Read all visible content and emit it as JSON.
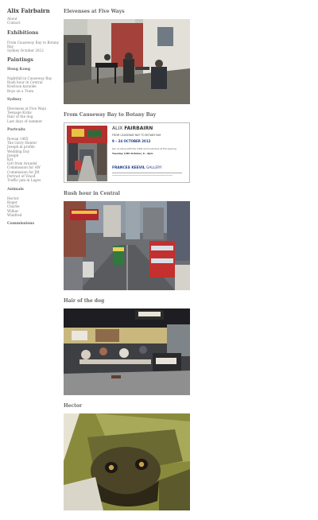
{
  "site": {
    "title": "Alix Fairbairn"
  },
  "nav": {
    "links": [
      "About",
      "Contact"
    ]
  },
  "exhibitions": {
    "heading": "Exhibitions",
    "items": [
      "From Causeway Bay to Botany",
      "Bay",
      "Sydney October 2012"
    ]
  },
  "paintings": {
    "heading": "Paintings"
  },
  "hongkong": {
    "heading": "Hong Kong",
    "items": [
      "Nightfall in Causeway Bay",
      "Rush hour in Central",
      "Kowloon karaoke",
      "Boys on a Tram"
    ]
  },
  "sydney": {
    "heading": "Sydney",
    "items": [
      "Elevenses at Five Ways",
      "Teenage Kicks",
      "Hair of the dog",
      "Last days of summer"
    ]
  },
  "portraits": {
    "heading": "Portraits",
    "items": [
      "Rowan 1465",
      "The Glory Hunter",
      "Joseph in profile",
      "Wedding Day",
      "Joseph",
      "Kat",
      "Girl from Arundel",
      "Commission for AW",
      "Commission for JM",
      "Portrait of Vinod",
      "Traffic jam in Lagos"
    ]
  },
  "animals": {
    "heading": "Animals",
    "items": [
      "Hector",
      "Roger",
      "Charlie",
      "Wilbur",
      "Winifred"
    ]
  },
  "commissions": {
    "heading": "Commissions"
  },
  "posts": [
    {
      "title": "Elevenses at Five Ways"
    },
    {
      "title": "From Causeway Bay to Botany Bay"
    },
    {
      "title": "Rush hour in Central"
    },
    {
      "title": "Hair of the dog"
    },
    {
      "title": "Hector"
    }
  ],
  "flyer": {
    "artist_first": "ALIX",
    "artist_last": "FAIRBAIRN",
    "show": "FROM CAUSEWAY BAY TO BOTANY BAY",
    "dates": "9 – 24 OCTOBER 2012",
    "invite": "Join us along with the artist and musicians at the opening",
    "opening": "Tuesday 13th October, 6 - 9pm",
    "gallery_first": "FRANCES KEEVIL",
    "gallery_last": "GALLERY"
  },
  "colors": {
    "flyer_accent": "#1f3e8c"
  }
}
